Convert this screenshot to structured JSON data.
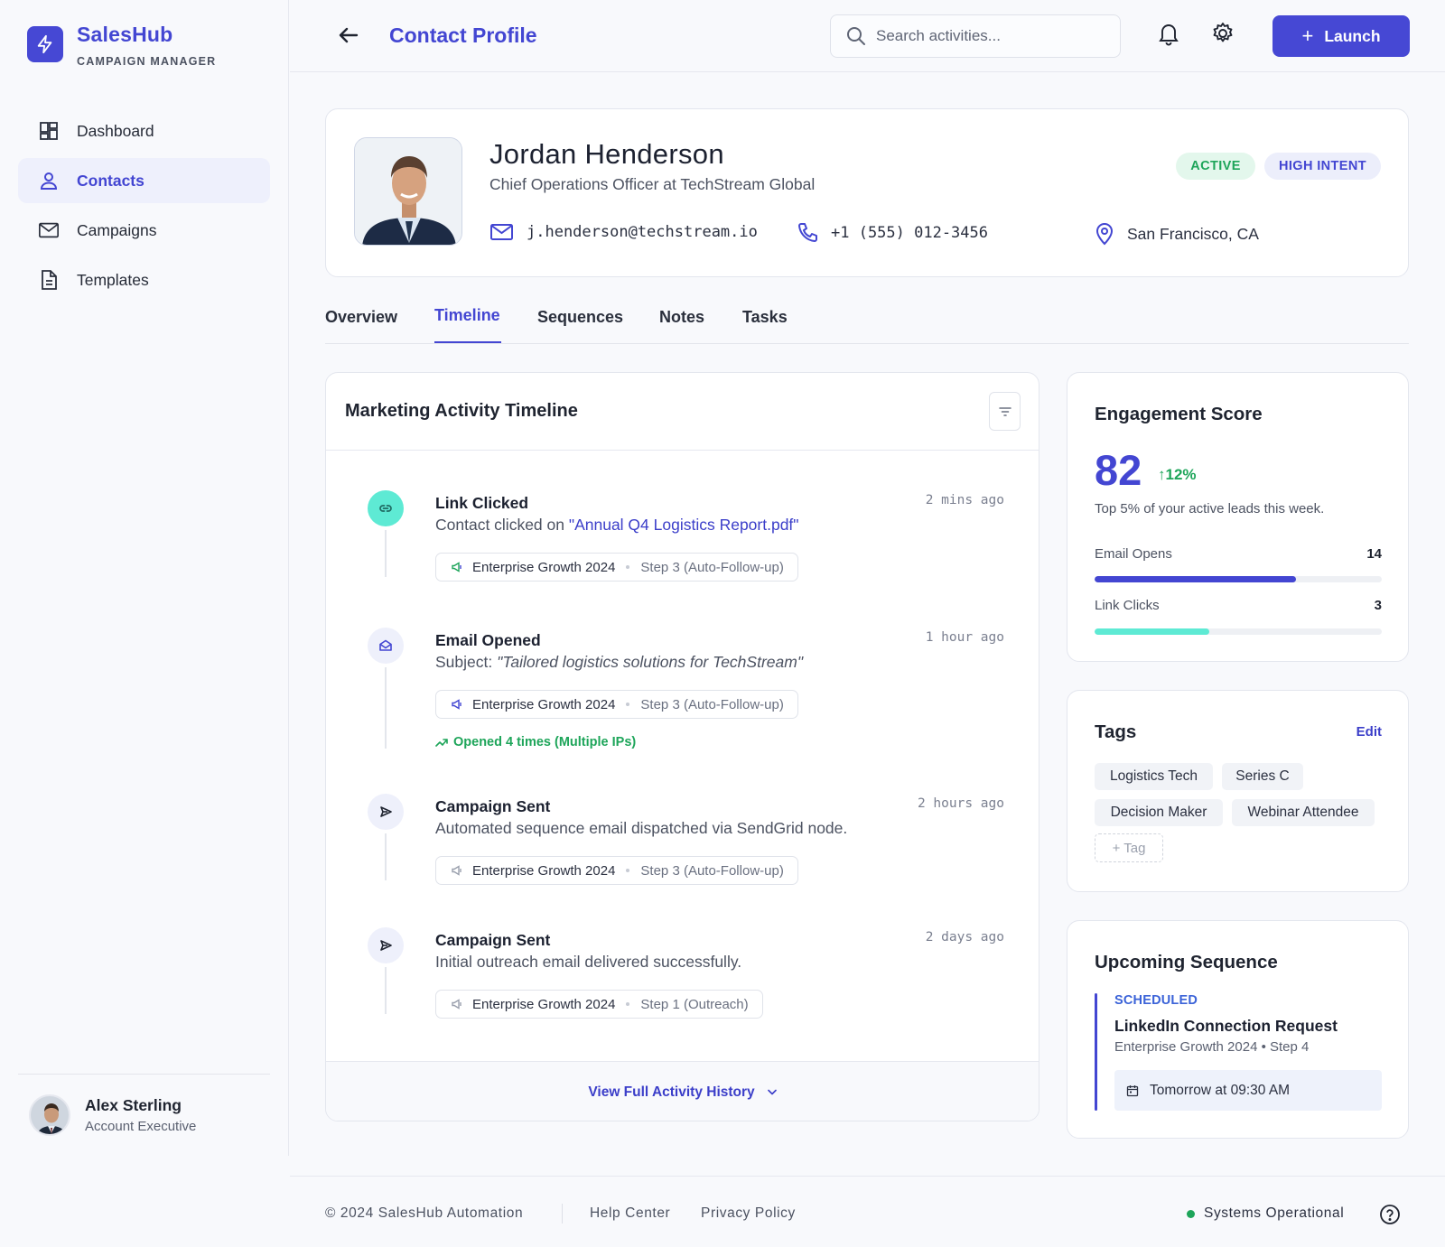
{
  "app": {
    "name": "SalesHub",
    "subtitle": "CAMPAIGN MANAGER",
    "accent": "#4648d4"
  },
  "sidebar": {
    "items": [
      {
        "label": "Dashboard",
        "icon": "dashboard-icon",
        "active": false
      },
      {
        "label": "Contacts",
        "icon": "user-icon",
        "active": true
      },
      {
        "label": "Campaigns",
        "icon": "mail-icon",
        "active": false
      },
      {
        "label": "Templates",
        "icon": "document-icon",
        "active": false
      }
    ],
    "user": {
      "name": "Alex Sterling",
      "role": "Account Executive"
    }
  },
  "header": {
    "title": "Contact Profile",
    "search_placeholder": "Search activities...",
    "launch_label": "Launch"
  },
  "contact": {
    "name": "Jordan Henderson",
    "title": "Chief Operations Officer at TechStream Global",
    "email": "j.henderson@techstream.io",
    "phone": "+1 (555) 012-3456",
    "location": "San Francisco, CA",
    "badges": [
      "ACTIVE",
      "HIGH INTENT"
    ]
  },
  "tabs": [
    "Overview",
    "Timeline",
    "Sequences",
    "Notes",
    "Tasks"
  ],
  "active_tab": "Timeline",
  "timeline": {
    "title": "Marketing Activity Timeline",
    "items": [
      {
        "title": "Link Clicked",
        "time": "2 mins ago",
        "desc_prefix": "Contact clicked on ",
        "desc_highlight": "\"Annual Q4 Logistics Report.pdf\"",
        "campaign": "Enterprise Growth 2024",
        "step": "Step 3 (Auto-Follow-up)",
        "icon": "link-icon",
        "color": "#5eead4"
      },
      {
        "title": "Email Opened",
        "time": "1 hour ago",
        "desc_prefix": "Subject: ",
        "desc_highlight": "\"Tailored logistics solutions for TechStream\"",
        "campaign": "Enterprise Growth 2024",
        "step": "Step 3 (Auto-Follow-up)",
        "note": "Opened 4 times (Multiple IPs)",
        "icon": "mail-open-icon",
        "color": "#eef0fb"
      },
      {
        "title": "Campaign Sent",
        "time": "2 hours ago",
        "desc_prefix": "Automated sequence email dispatched via SendGrid node.",
        "campaign": "Enterprise Growth 2024",
        "step": "Step 3 (Auto-Follow-up)",
        "icon": "send-icon",
        "color": "#eef0fb"
      },
      {
        "title": "Campaign Sent",
        "time": "2 days ago",
        "desc_prefix": "Initial outreach email delivered successfully.",
        "campaign": "Enterprise Growth 2024",
        "step": "Step 1 (Outreach)",
        "icon": "send-icon",
        "color": "#eef0fb"
      }
    ],
    "footer_link": "View Full Activity History"
  },
  "engagement": {
    "title": "Engagement Score",
    "score": "82",
    "delta": "12%",
    "subtitle": "Top 5% of your active leads this week.",
    "metrics": [
      {
        "label": "Email Opens",
        "value": "14",
        "fill": 0.7,
        "color": "#4346d2"
      },
      {
        "label": "Link Clicks",
        "value": "3",
        "fill": 0.4,
        "color": "#5eead4"
      }
    ]
  },
  "tags": {
    "title": "Tags",
    "edit_label": "Edit",
    "items": [
      "Logistics Tech",
      "Series C",
      "Decision Maker",
      "Webinar Attendee"
    ],
    "add_label": "+ Tag"
  },
  "sequence": {
    "title": "Upcoming Sequence",
    "status": "SCHEDULED",
    "name": "LinkedIn Connection Request",
    "meta": "Enterprise Growth 2024 • Step 4",
    "when": "Tomorrow at 09:30 AM"
  },
  "footer": {
    "copyright": "© 2024 SalesHub Automation",
    "links": [
      "Help Center",
      "Privacy Policy"
    ],
    "status": "Systems Operational"
  }
}
